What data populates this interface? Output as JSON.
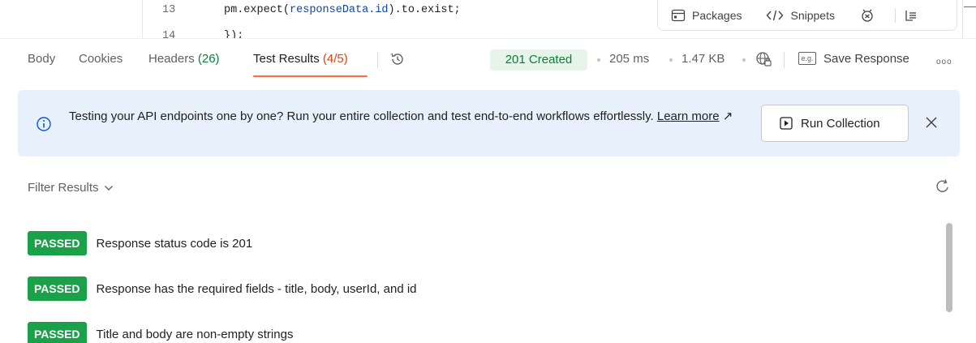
{
  "editor": {
    "lines": [
      {
        "number": "13",
        "code_pre": "pm.expect(",
        "code_var": "responseData.id",
        "code_post": ").to.exist;"
      },
      {
        "number": "14",
        "code": "});"
      }
    ],
    "tools": {
      "packages": "Packages",
      "snippets": "Snippets"
    }
  },
  "response_tabs": {
    "body": "Body",
    "cookies": "Cookies",
    "headers_label": "Headers",
    "headers_count": "(26)",
    "test_results_label": "Test Results",
    "test_results_count": "(4/5)"
  },
  "status": {
    "code_text": "201 Created",
    "time": "205 ms",
    "size": "1.47 KB",
    "save_response": "Save Response",
    "eg_label": "e.g.",
    "more": "ooo"
  },
  "banner": {
    "message": "Testing your API endpoints one by one? Run your entire collection and test end-to-end workflows effortlessly.",
    "link": "Learn more",
    "link_arrow": "↗",
    "run_button": "Run Collection"
  },
  "filter": {
    "label": "Filter Results"
  },
  "results": [
    {
      "status": "PASSED",
      "label": "Response status code is 201"
    },
    {
      "status": "PASSED",
      "label": "Response has the required fields - title, body, userId, and id"
    },
    {
      "status": "PASSED",
      "label": "Title and body are non-empty strings"
    }
  ],
  "colors": {
    "accent": "#ff6c37",
    "success": "#1aa14a",
    "success_bg": "#e6f4ea",
    "banner_bg": "#e8f0fb"
  }
}
